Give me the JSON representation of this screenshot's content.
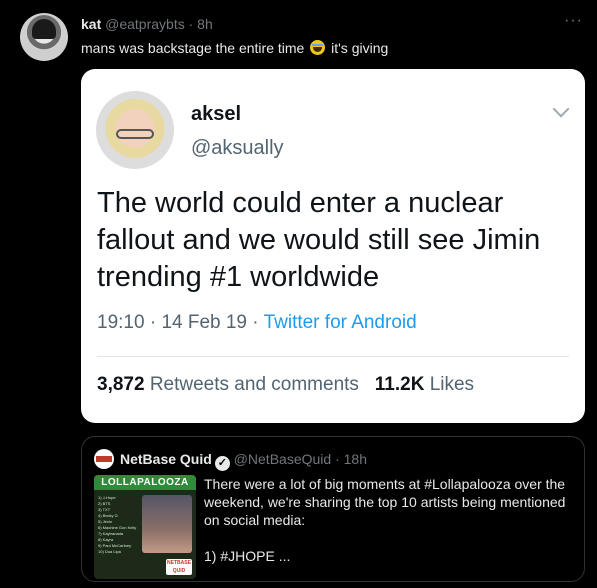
{
  "tweet": {
    "display_name": "kat",
    "handle": "@eatpraybts",
    "separator": "·",
    "time": "8h",
    "text_before_emoji": "mans was backstage the entire time",
    "emoji_icon": "loudly-crying-face-emoji",
    "text_after_emoji": "it's giving",
    "more_label": "···"
  },
  "screenshot_card": {
    "name": "aksel",
    "handle": "@aksually",
    "text": "The world could enter a nuclear fallout and we would still see Jimin trending #1 worldwide",
    "time": "19:10",
    "date": "14 Feb 19",
    "source": "Twitter for Android",
    "retweets_count": "3,872",
    "retweets_label": "Retweets and comments",
    "likes_count": "11.2K",
    "likes_label": "Likes",
    "chevron_icon": "chevron-down-icon"
  },
  "quote_tweet": {
    "name": "NetBase Quid",
    "handle": "@NetBaseQuid",
    "time": "18h",
    "verified_icon": "verified-badge-icon",
    "text": "There were a lot of big moments at #Lollapalooza over the weekend, we're sharing the top 10 artists being mentioned on social media:",
    "tail": "1) #JHOPE ...",
    "image": {
      "banner": "LOLLAPALOOZA",
      "list": [
        "1) J-Hope",
        "2) BTS",
        "3) TXT",
        "4) Becky G",
        "5) Jimin",
        "6) Machine Gun Kelly",
        "7) Kaytranada",
        "8) Kayra",
        "9) Paul McCartney",
        "10) Dua Lipa"
      ],
      "logo": "NETBASE QUID"
    }
  }
}
